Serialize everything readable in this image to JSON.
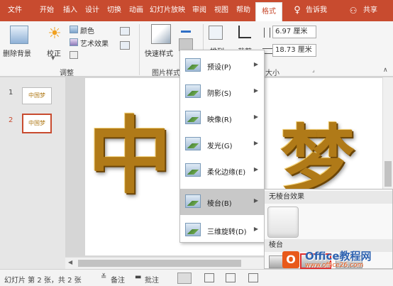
{
  "tabs": [
    "文件",
    "开始",
    "插入",
    "设计",
    "切换",
    "动画",
    "幻灯片放映",
    "审阅",
    "视图",
    "帮助",
    "格式"
  ],
  "active_tab": "格式",
  "tell_me": "告诉我",
  "share": "共享",
  "ribbon": {
    "remove_bg": "删除背景",
    "correct": "校正",
    "color": "颜色",
    "art_effects": "艺术效果",
    "adjust_group": "调整",
    "quick_styles": "快速样式",
    "picture_styles_group": "图片样式",
    "arrange": "排列",
    "crop": "裁剪",
    "size_group": "大小",
    "height": "6.97 厘米",
    "width": "18.73 厘米"
  },
  "slides": {
    "numbers": [
      "1",
      "2"
    ],
    "thumb_text": "中国梦",
    "current": "2"
  },
  "slide_text": {
    "left": "中",
    "right": "梦"
  },
  "effects_menu": {
    "items": [
      {
        "label": "预设(P)",
        "icon": "preset-icon"
      },
      {
        "label": "阴影(S)",
        "icon": "shadow-icon"
      },
      {
        "label": "映像(R)",
        "icon": "reflection-icon"
      },
      {
        "label": "发光(G)",
        "icon": "glow-icon"
      },
      {
        "label": "柔化边缘(E)",
        "icon": "soft-edges-icon"
      },
      {
        "label": "棱台(B)",
        "icon": "bevel-icon"
      },
      {
        "label": "三维旋转(D)",
        "icon": "3d-rotation-icon"
      }
    ],
    "highlighted": "棱台(B)"
  },
  "bevel_submenu": {
    "no_bevel": "无棱台效果",
    "bevel": "棱台"
  },
  "status": {
    "slide_info": "幻灯片 第 2 张，共 2 张",
    "notes": "备注",
    "comments": "批注"
  },
  "watermark": {
    "brand": "Office教程网",
    "url": "www.office26.com"
  },
  "colors": {
    "accent": "#c84b2f",
    "highlight": "#c8c8c8",
    "gold": "#b07a18"
  }
}
